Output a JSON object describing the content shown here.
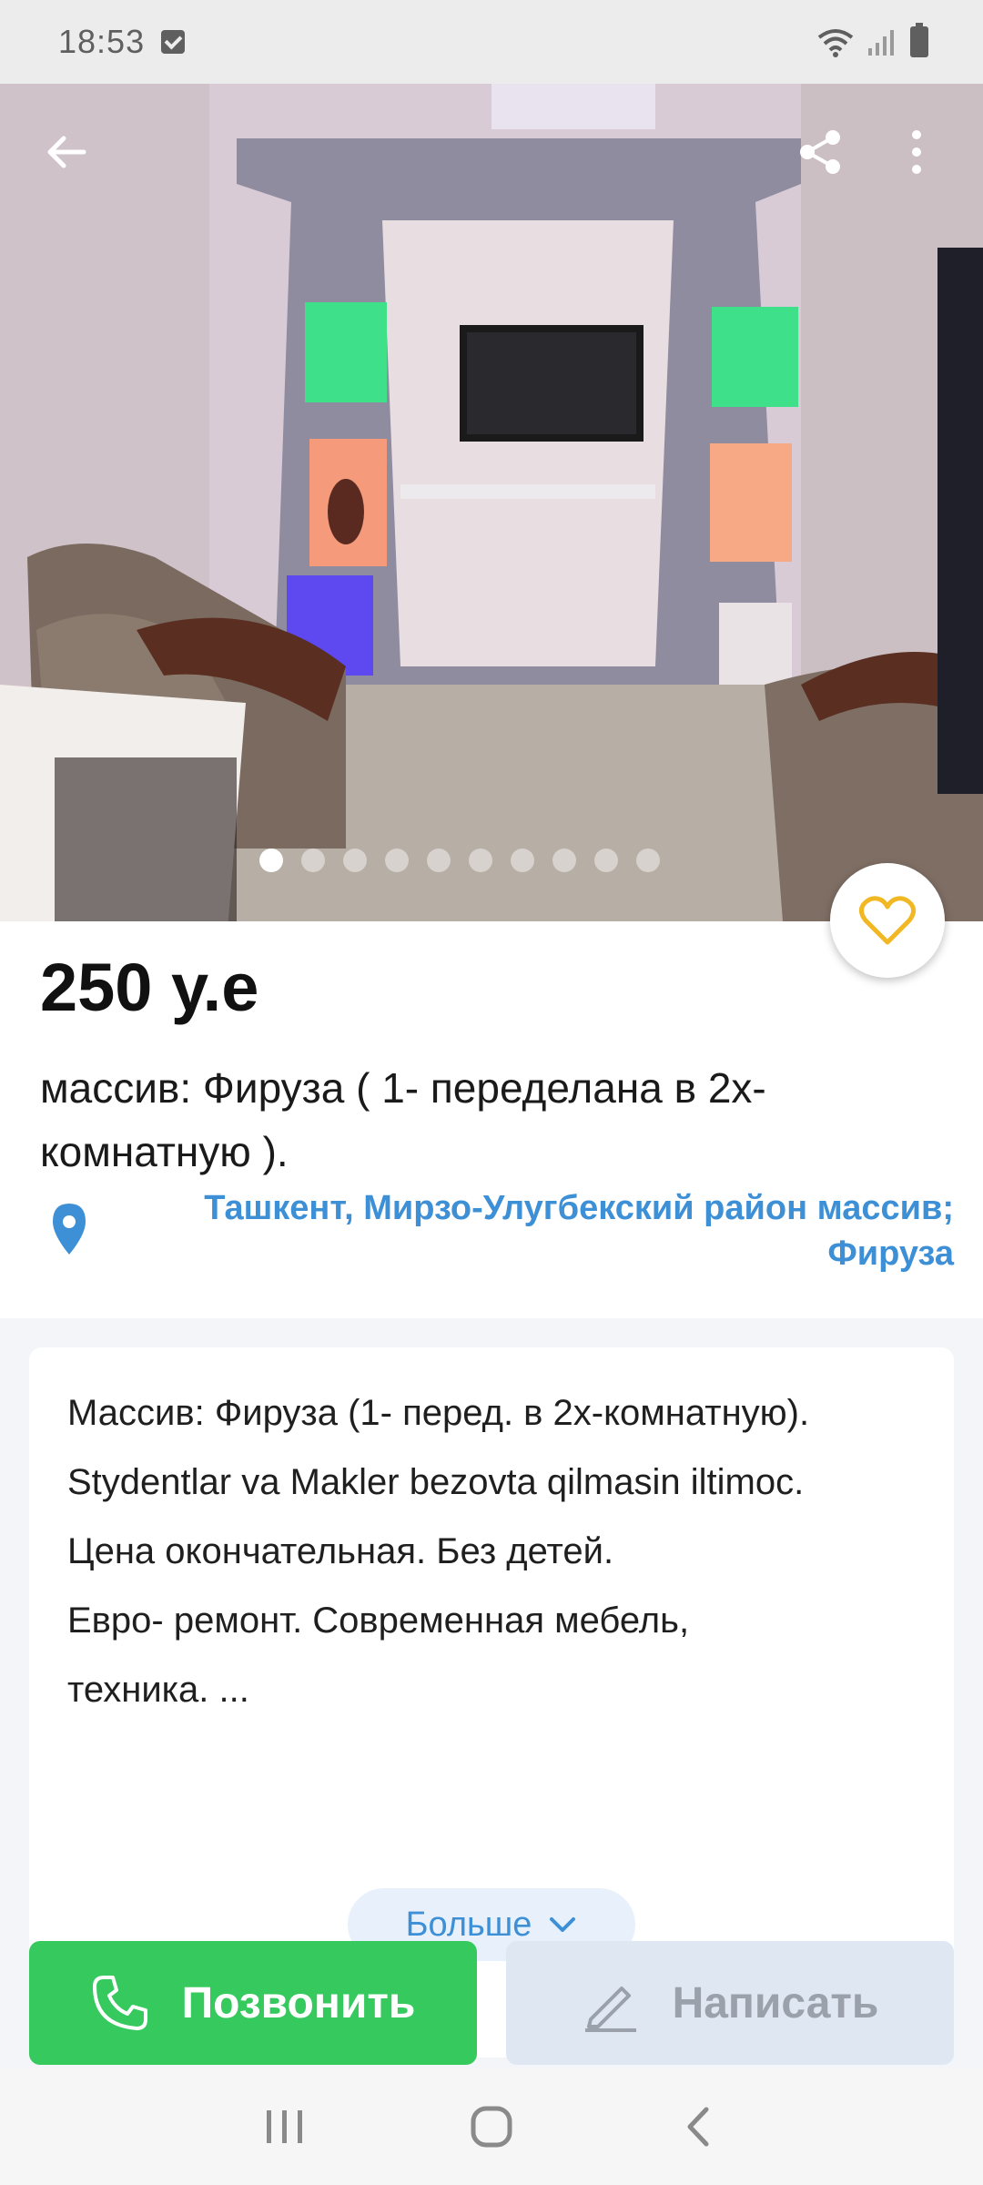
{
  "status_bar": {
    "time": "18:53"
  },
  "hero": {
    "photo_count": 10,
    "active_index": 0,
    "icons": [
      "back-arrow-icon",
      "share-icon",
      "more-vertical-icon",
      "heart-icon"
    ]
  },
  "listing": {
    "price": "250 у.е",
    "title": "массив: Фируза  ( 1- переделана в  2х-комнатную ).",
    "location": "Ташкент, Мирзо-Улугбекский район массив; Фируза",
    "description": "Массив:  Фируза (1- перед. в 2х-комнатную).\nStydentlar va Makler bezovta qilmasin iltimoc.\nЦена окончательная.  Без детей.\nЕвро- ремонт. Современная мебель, техника. ...",
    "more_label": "Больше"
  },
  "actions": {
    "call_label": "Позвонить",
    "write_label": "Написать"
  },
  "colors": {
    "accent_blue": "#3d8fd6",
    "call_green": "#35c95e",
    "write_bg": "#dfe7f3",
    "heart_yellow": "#f2b824"
  }
}
